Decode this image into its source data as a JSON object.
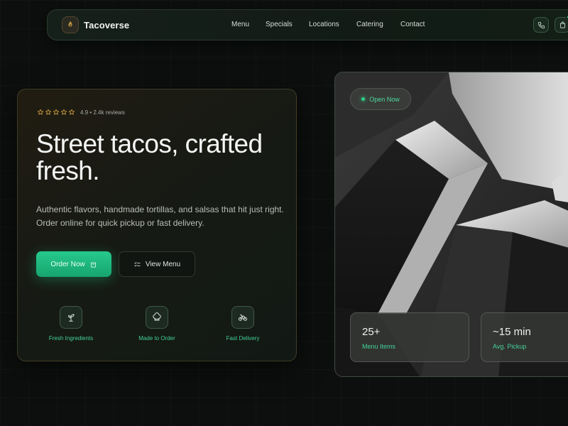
{
  "nav": {
    "brand": "Tacoverse",
    "links": [
      "Menu",
      "Specials",
      "Locations",
      "Catering",
      "Contact"
    ],
    "phone_icon": "phone-icon",
    "cart_icon": "bag-icon"
  },
  "hero": {
    "rating_stars": 5,
    "rating_text": "4.9 • 2.4k reviews",
    "headline_line1": "Street tacos, crafted",
    "headline_line2": "fresh.",
    "subtext": "Authentic flavors, handmade tortillas, and salsas that hit just right. Order online for quick pickup or fast delivery.",
    "primary_button": "Order Now",
    "secondary_button": "View Menu",
    "features": [
      {
        "label": "Fresh Ingredients",
        "icon": "sprout-icon"
      },
      {
        "label": "Made to Order",
        "icon": "chef-hat-icon"
      },
      {
        "label": "Fast Delivery",
        "icon": "bike-icon"
      }
    ]
  },
  "image_card": {
    "status": "Open Now",
    "stats": [
      {
        "value": "25+",
        "label": "Menu Items"
      },
      {
        "value": "~15 min",
        "label": "Avg. Pickup"
      }
    ]
  },
  "colors": {
    "accent": "#2fd08a",
    "background": "#0c0f0d",
    "star": "#d9a441"
  }
}
